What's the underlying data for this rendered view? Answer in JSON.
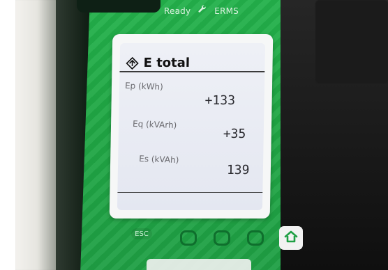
{
  "device": {
    "status_text": "Ready",
    "status_extra": "ERMS"
  },
  "screen": {
    "title": "E total",
    "rows": [
      {
        "label": "Ep (kWh)",
        "value": "+133"
      },
      {
        "label": "Eq (kVArh)",
        "value": "+35"
      },
      {
        "label": "Es (kVAh)",
        "value": "139"
      }
    ]
  },
  "controls": {
    "esc_label": "ESC",
    "buttons": [
      "button-1",
      "button-2",
      "button-3"
    ],
    "home_icon": "home-icon"
  },
  "colors": {
    "panel_green": "#20a845",
    "screen_bg": "#e9ebf3",
    "text_dark": "#111111"
  }
}
